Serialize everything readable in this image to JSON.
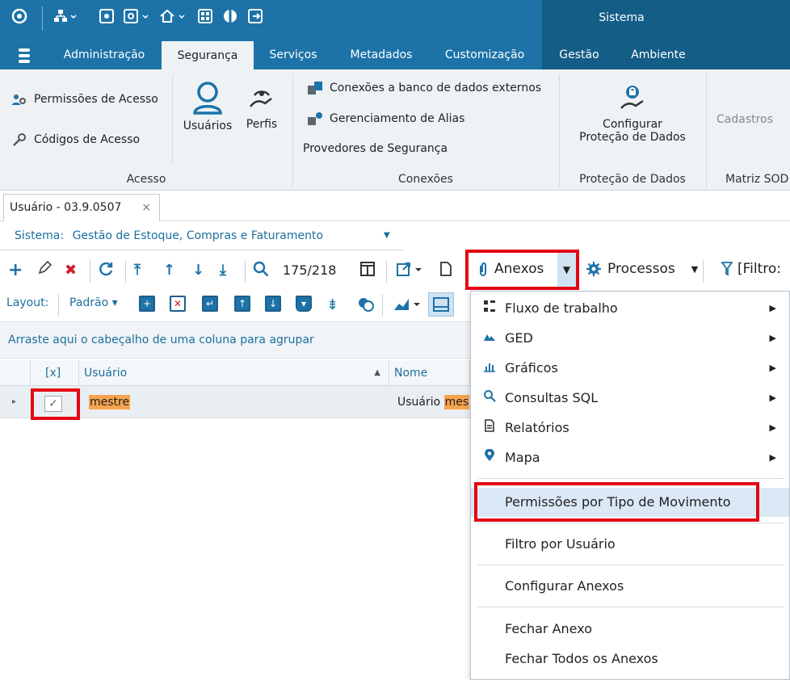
{
  "titlebar": {
    "system_label": "Sistema"
  },
  "menubar": {
    "tabs": [
      {
        "label": "Administração"
      },
      {
        "label": "Segurança",
        "active": true
      },
      {
        "label": "Serviços"
      },
      {
        "label": "Metadados"
      },
      {
        "label": "Customização"
      },
      {
        "label": "Gestão"
      },
      {
        "label": "Ambiente"
      }
    ]
  },
  "ribbon": {
    "acesso": {
      "permissoes": "Permissões de Acesso",
      "codigos": "Códigos de Acesso",
      "usuarios": "Usuários",
      "perfis": "Perfis",
      "group_label": "Acesso"
    },
    "conexoes": {
      "externos": "Conexões a banco de dados externos",
      "alias": "Gerenciamento de Alias",
      "provedores": "Provedores de Segurança",
      "group_label": "Conexões"
    },
    "protecao": {
      "configurar_line1": "Configurar",
      "configurar_line2": "Proteção de Dados",
      "group_label": "Proteção de Dados"
    },
    "matriz": {
      "cadastros": "Cadastros",
      "group_label": "Matriz SOD"
    }
  },
  "document_tab": {
    "title": "Usuário - 03.9.0507",
    "close": "×"
  },
  "sistema": {
    "label": "Sistema:",
    "value": "Gestão de Estoque, Compras e Faturamento"
  },
  "toolbar": {
    "counter": "175/218",
    "anexos": "Anexos",
    "processos": "Processos",
    "filtro": "[Filtro:"
  },
  "layout_toolbar": {
    "label": "Layout:",
    "preset": "Padrão"
  },
  "group_panel": {
    "text": "Arraste aqui o cabeçalho de uma coluna para agrupar"
  },
  "grid": {
    "columns": [
      "[x]",
      "Usuário",
      "Nome"
    ],
    "rows": [
      {
        "checked": true,
        "usuario": "mestre",
        "nome_prefix": "Usuário",
        "nome_hl": "mes"
      }
    ]
  },
  "menu": {
    "items": [
      {
        "label": "Fluxo de trabalho",
        "icon": "workflow-icon",
        "submenu": true
      },
      {
        "label": "GED",
        "icon": "ged-icon",
        "submenu": true
      },
      {
        "label": "Gráficos",
        "icon": "chart-icon",
        "submenu": true
      },
      {
        "label": "Consultas SQL",
        "icon": "search-icon",
        "submenu": true
      },
      {
        "label": "Relatórios",
        "icon": "report-icon",
        "submenu": true
      },
      {
        "label": "Mapa",
        "icon": "map-pin-icon",
        "submenu": true
      },
      {
        "label": "Permissões por Tipo de Movimento",
        "selected": true
      },
      {
        "label": "Filtro por Usuário"
      },
      {
        "label": "Configurar Anexos"
      },
      {
        "label": "Fechar Anexo"
      },
      {
        "label": "Fechar Todos os Anexos"
      }
    ]
  },
  "colors": {
    "title_blue": "#1d73a8",
    "dark_blue": "#145d87",
    "highlight_orange": "#f6a44f",
    "callout_red": "#e30613"
  }
}
